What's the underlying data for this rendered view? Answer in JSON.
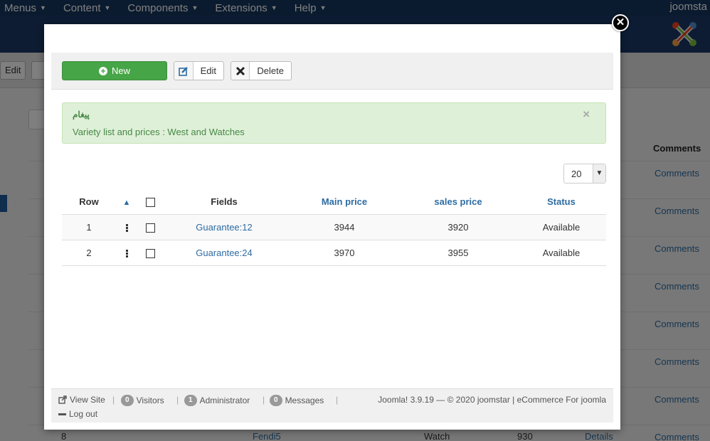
{
  "background": {
    "menu": [
      "Menus",
      "Content",
      "Components",
      "Extensions",
      "Help"
    ],
    "user": "joomsta",
    "edit_label": "Edit",
    "comments_header": "Comments",
    "comments_link": "Comments",
    "bottom_row": {
      "index": "8",
      "name": "Fendi5",
      "type": "Watch",
      "price": "930",
      "details": "Details"
    }
  },
  "toolbar": {
    "new_label": "New",
    "edit_label": "Edit",
    "delete_label": "Delete"
  },
  "alert": {
    "heading": "پیغام",
    "message": "Variety list and prices : West and Watches",
    "close": "×"
  },
  "pagination": {
    "limit": "20"
  },
  "table": {
    "headers": {
      "row": "Row",
      "fields": "Fields",
      "main_price": "Main price",
      "sales_price": "sales price",
      "status": "Status"
    },
    "rows": [
      {
        "row": "1",
        "field": "Guarantee:12",
        "main_price": "3944",
        "sales_price": "3920",
        "status": "Available"
      },
      {
        "row": "2",
        "field": "Guarantee:24",
        "main_price": "3970",
        "sales_price": "3955",
        "status": "Available"
      }
    ]
  },
  "footer": {
    "view_site": "View Site",
    "visitors_count": "0",
    "visitors_label": "Visitors",
    "admin_count": "1",
    "admin_label": "Administrator",
    "messages_count": "0",
    "messages_label": "Messages",
    "copyright": "Joomla! 3.9.19  —  © 2020 joomstar | eCommerce For joomla",
    "logout": "Log out"
  },
  "colors": {
    "accent": "#2d6ca2",
    "new_button": "#46a546",
    "alert_bg": "#dff0d8",
    "header": "#1a3867"
  }
}
